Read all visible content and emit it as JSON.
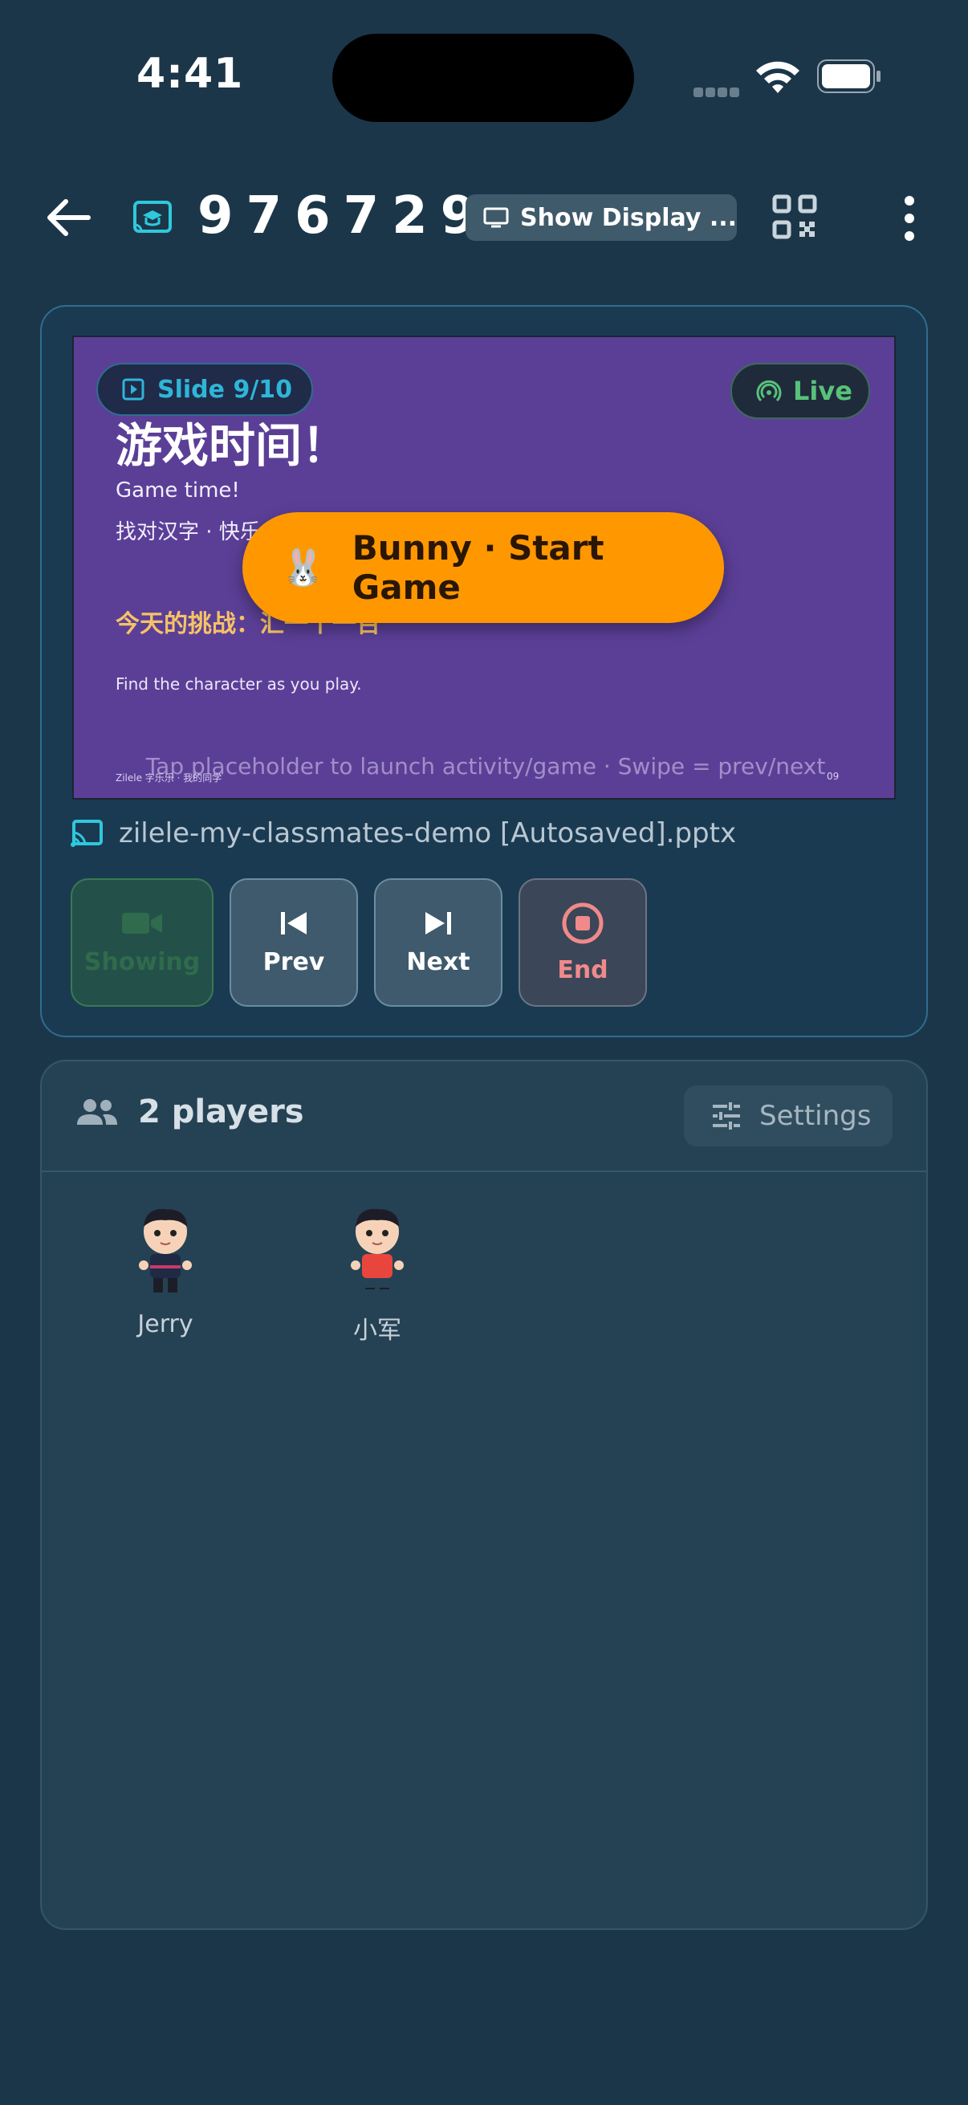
{
  "status_bar": {
    "time": "4:41"
  },
  "top_bar": {
    "room_code": "976729",
    "display_button_label": "Show Display ...",
    "icons": [
      "back-arrow-icon",
      "cast-classroom-icon",
      "monitor-icon",
      "qr-code-icon",
      "more-vertical-icon"
    ]
  },
  "slide": {
    "badge_label": "Slide 9/10",
    "live_label": "Live",
    "title": "游戏时间！",
    "line1": "Game time!",
    "line2": "找对汉字 · 快乐",
    "challenge": "今天的挑战：汇一个一百",
    "find_text": "Find the character as you play.",
    "footer_left": "Zilele 字乐乐 · 我的同学",
    "footer_right": "09",
    "hint": "Tap placeholder to launch activity/game · Swipe = prev/next"
  },
  "start_game": {
    "emoji": "🐰",
    "label": "Bunny · Start Game",
    "color": "#ff9800"
  },
  "file": {
    "name": "zilele-my-classmates-demo [Autosaved].pptx"
  },
  "controls": {
    "showing": "Showing",
    "prev": "Prev",
    "next": "Next",
    "end": "End"
  },
  "players": {
    "count_label": "2 players",
    "settings_label": "Settings",
    "list": [
      {
        "name": "Jerry",
        "shirt_color": "#1f2a44"
      },
      {
        "name": "小军",
        "shirt_color": "#e8463c"
      }
    ]
  }
}
